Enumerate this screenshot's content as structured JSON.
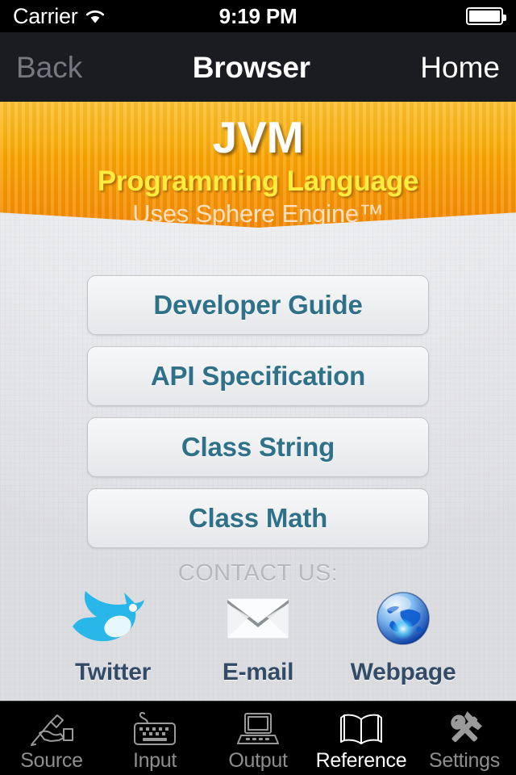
{
  "statusbar": {
    "carrier": "Carrier",
    "wifi_icon": "wifi-icon",
    "time": "9:19 PM",
    "battery_icon": "battery-full-icon"
  },
  "navbar": {
    "back_label": "Back",
    "title": "Browser",
    "home_label": "Home"
  },
  "banner": {
    "title": "JVM",
    "subtitle": "Programming Language",
    "engine": "Uses Sphere Engine™",
    "colors": {
      "top": "#fdb305",
      "bottom": "#f58a06",
      "subtitle_color": "#ffec3f",
      "title_color": "#ffffff"
    }
  },
  "menu": {
    "accent_color": "#2f7189",
    "buttons": [
      {
        "label": "Developer Guide"
      },
      {
        "label": "API Specification"
      },
      {
        "label": "Class String"
      },
      {
        "label": "Class Math"
      }
    ]
  },
  "contact": {
    "heading": "CONTACT US:",
    "items": [
      {
        "label": "Twitter",
        "icon": "twitter-bird-icon"
      },
      {
        "label": "E-mail",
        "icon": "envelope-icon"
      },
      {
        "label": "Webpage",
        "icon": "globe-icon"
      }
    ]
  },
  "tabbar": {
    "active_index": 3,
    "active_color": "#ffffff",
    "inactive_color": "#8e8e8e",
    "tabs": [
      {
        "label": "Source",
        "icon": "hand-writing-pen-icon"
      },
      {
        "label": "Input",
        "icon": "keyboard-icon"
      },
      {
        "label": "Output",
        "icon": "laptop-icon"
      },
      {
        "label": "Reference",
        "icon": "open-book-icon"
      },
      {
        "label": "Settings",
        "icon": "hammer-wrench-icon"
      }
    ]
  }
}
